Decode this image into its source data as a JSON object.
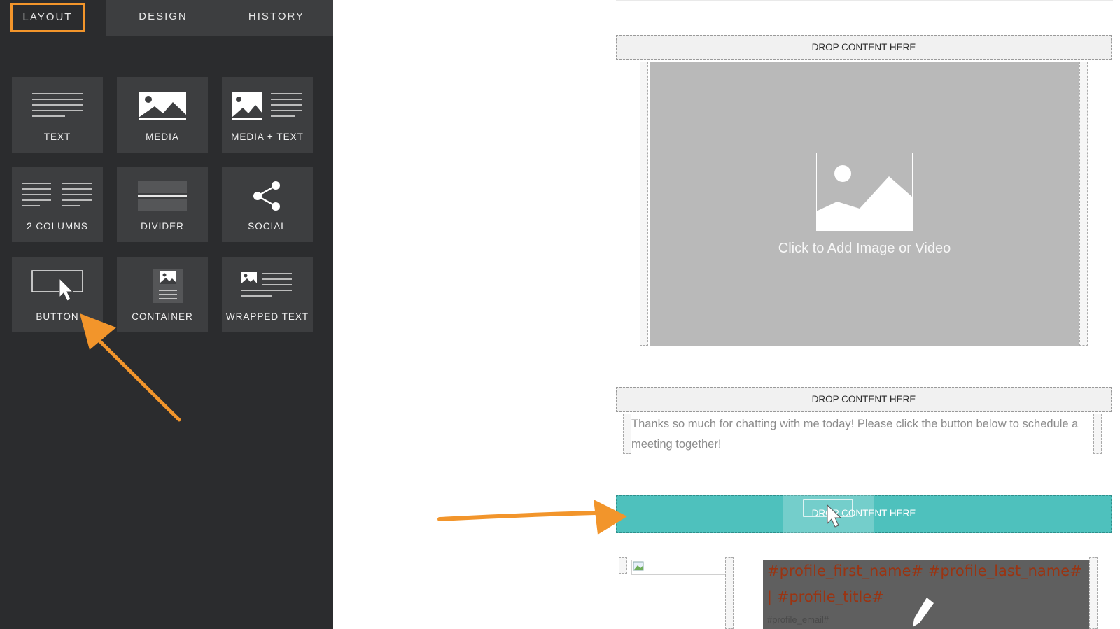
{
  "sidebar": {
    "tabs": [
      {
        "label": "LAYOUT",
        "active": true
      },
      {
        "label": "DESIGN",
        "active": false
      },
      {
        "label": "HISTORY",
        "active": false
      }
    ],
    "tiles": [
      {
        "label": "TEXT",
        "icon": "text-lines-icon"
      },
      {
        "label": "MEDIA",
        "icon": "image-icon"
      },
      {
        "label": "MEDIA + TEXT",
        "icon": "image-text-icon"
      },
      {
        "label": "2 COLUMNS",
        "icon": "two-columns-icon"
      },
      {
        "label": "DIVIDER",
        "icon": "divider-icon"
      },
      {
        "label": "SOCIAL",
        "icon": "share-icon"
      },
      {
        "label": "BUTTON",
        "icon": "button-cursor-icon"
      },
      {
        "label": "CONTAINER",
        "icon": "container-icon"
      },
      {
        "label": "WRAPPED TEXT",
        "icon": "wrapped-text-icon"
      }
    ]
  },
  "canvas": {
    "drop_label_1": "DROP CONTENT HERE",
    "media_placeholder": "Click to Add Image or Video",
    "drop_label_2": "DROP CONTENT HERE",
    "body_text": "Thanks so much for chatting with me today! Please click the button below to schedule a meeting together!",
    "drop_label_3": "DROP CONTENT HERE",
    "dragged_label": "BUTTON",
    "profile": {
      "name_line": "#profile_first_name# #profile_last_name#",
      "title_line": "| #profile_title#",
      "email": "#profile_email#"
    }
  },
  "colors": {
    "accent_orange": "#f2952b",
    "teal_drop": "#4ec1bd",
    "sidebar_bg": "#2b2c2e",
    "tile_bg": "#3d3e40",
    "profile_text": "#9a3412"
  }
}
